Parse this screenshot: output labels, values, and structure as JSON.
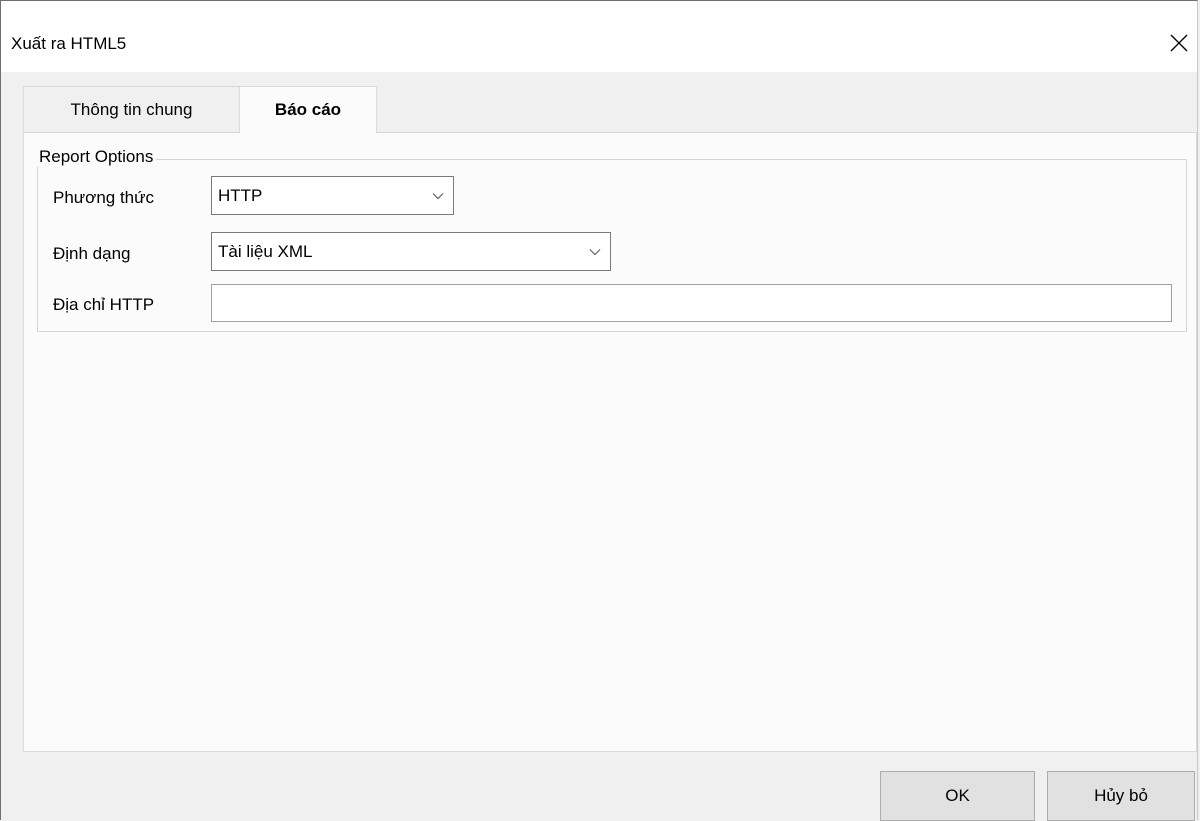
{
  "window": {
    "title": "Xuất ra HTML5",
    "close_icon": "close-icon"
  },
  "tabs": [
    {
      "label": "Thông tin chung",
      "active": false
    },
    {
      "label": "Báo cáo",
      "active": true
    }
  ],
  "report_options": {
    "group_title": "Report Options",
    "method": {
      "label": "Phương thức",
      "value": "HTTP",
      "icon": "chevron-down-icon"
    },
    "format": {
      "label": "Định dạng",
      "value": "Tài liệu XML",
      "icon": "chevron-down-icon"
    },
    "http_address": {
      "label": "Địa chỉ HTTP",
      "value": "",
      "placeholder": ""
    }
  },
  "buttons": {
    "ok_label": "OK",
    "cancel_label": "Hủy bỏ"
  },
  "colors": {
    "window_bg": "#f0f0f0",
    "page_bg": "#fbfbfb",
    "titlebar_bg": "#ffffff",
    "button_bg": "#e1e1e1"
  }
}
